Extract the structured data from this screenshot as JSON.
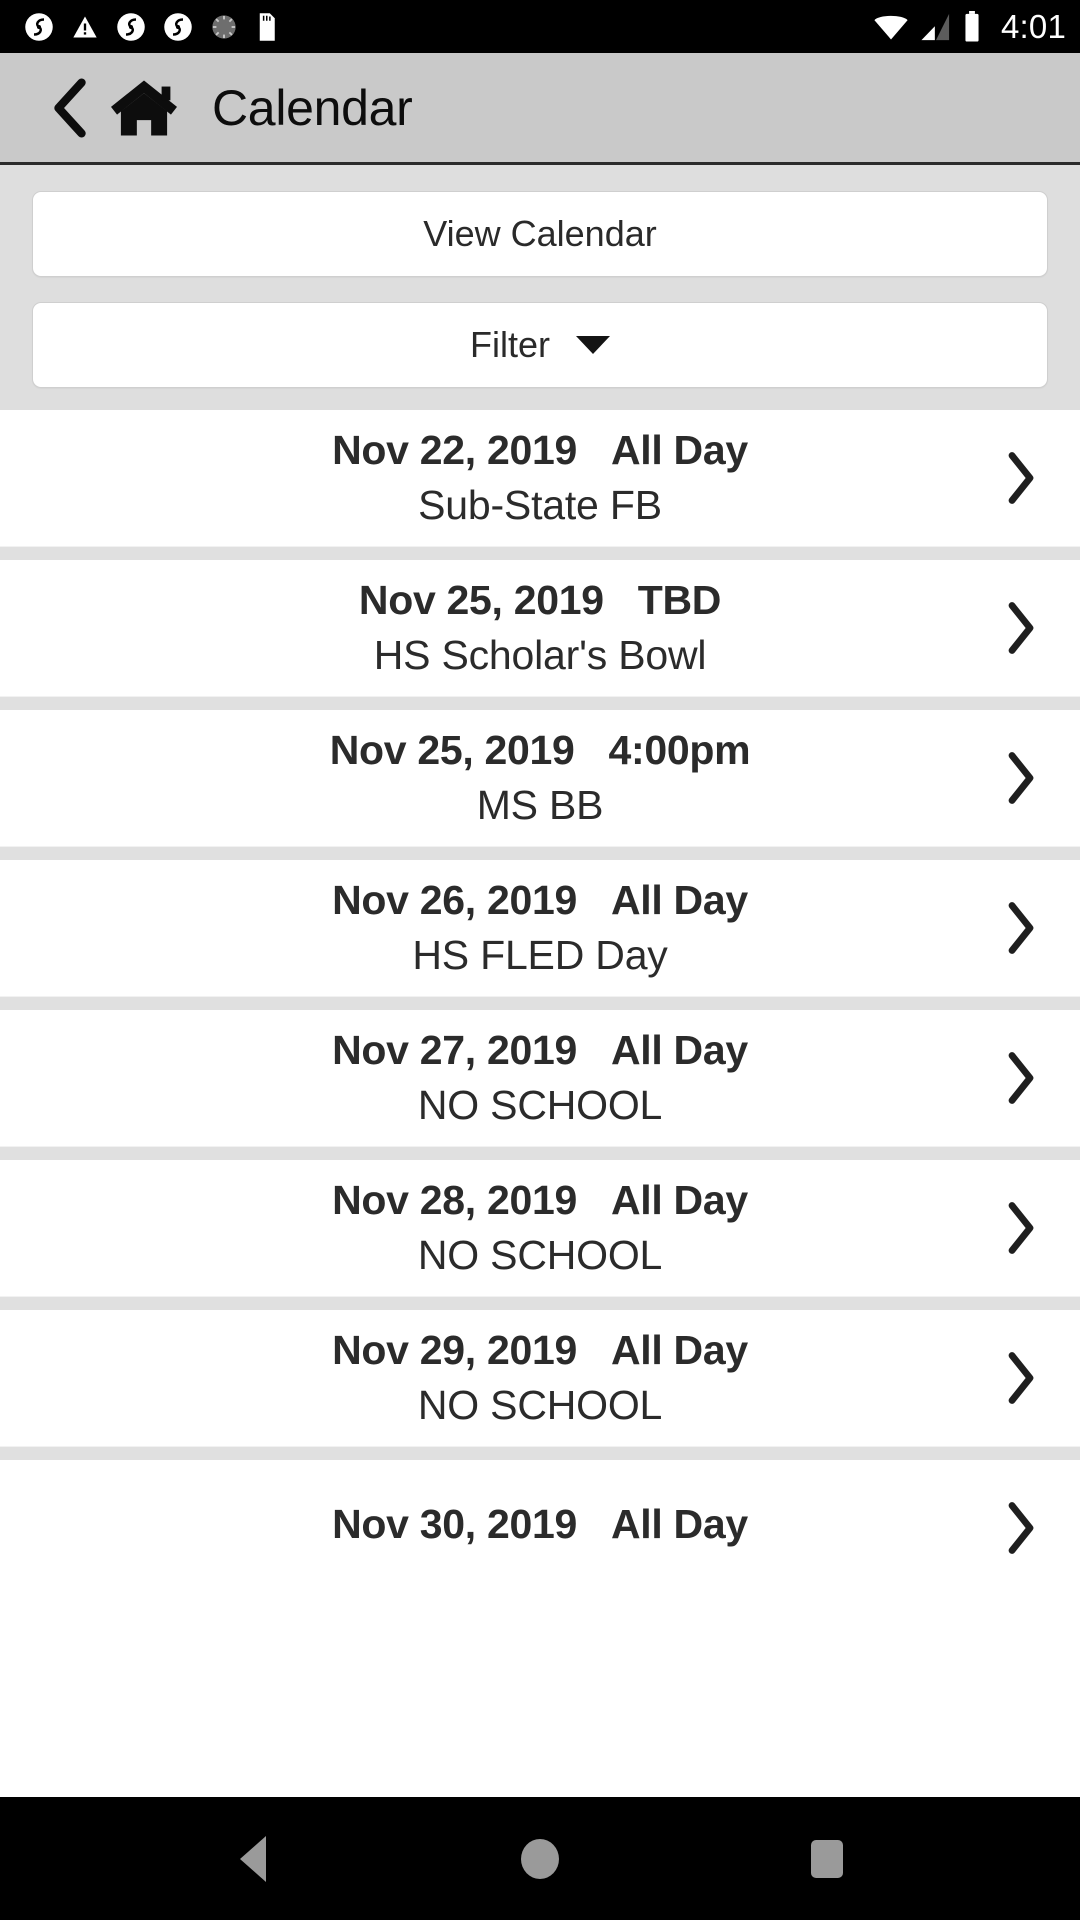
{
  "status_bar": {
    "time": "4:01",
    "left_icons": [
      "app-logo-icon",
      "warning-triangle-icon",
      "app-logo-icon",
      "app-logo-icon",
      "sync-spinner-icon",
      "sd-card-icon"
    ],
    "right_icons": [
      "wifi-icon",
      "cellular-signal-icon",
      "battery-icon"
    ]
  },
  "header": {
    "title": "Calendar",
    "back_icon": "chevron-left-icon",
    "home_icon": "home-icon",
    "background_color": "#c9c9c9"
  },
  "controls": {
    "view_calendar_label": "View Calendar",
    "filter_label": "Filter",
    "filter_caret_icon": "caret-down-icon"
  },
  "events": [
    {
      "date": "Nov 22, 2019",
      "time": "All Day",
      "title": "Sub-State FB",
      "chevron_icon": "chevron-right-icon"
    },
    {
      "date": "Nov 25, 2019",
      "time": "TBD",
      "title": "HS Scholar's Bowl",
      "chevron_icon": "chevron-right-icon"
    },
    {
      "date": "Nov 25, 2019",
      "time": "4:00pm",
      "title": "MS BB",
      "chevron_icon": "chevron-right-icon"
    },
    {
      "date": "Nov 26, 2019",
      "time": "All Day",
      "title": "HS FLED Day",
      "chevron_icon": "chevron-right-icon"
    },
    {
      "date": "Nov 27, 2019",
      "time": "All Day",
      "title": "NO SCHOOL",
      "chevron_icon": "chevron-right-icon"
    },
    {
      "date": "Nov 28, 2019",
      "time": "All Day",
      "title": "NO SCHOOL",
      "chevron_icon": "chevron-right-icon"
    },
    {
      "date": "Nov 29, 2019",
      "time": "All Day",
      "title": "NO SCHOOL",
      "chevron_icon": "chevron-right-icon"
    },
    {
      "date": "Nov 30, 2019",
      "time": "All Day",
      "title": "",
      "chevron_icon": "chevron-right-icon"
    }
  ],
  "nav_bar": {
    "back_icon": "triangle-back-icon",
    "home_icon": "circle-home-icon",
    "recents_icon": "square-recents-icon"
  }
}
